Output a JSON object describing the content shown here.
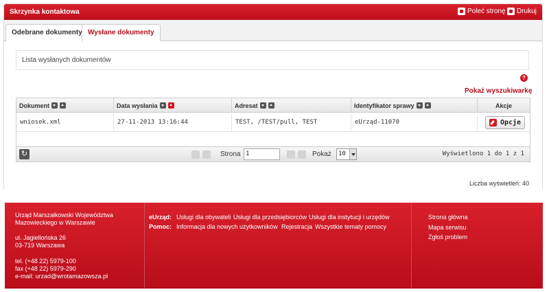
{
  "header": {
    "title": "Skrzynka kontaktowa",
    "recommend_label": "Poleć stronę",
    "print_label": "Drukuj"
  },
  "tabs": [
    {
      "label": "Odebrane dokumenty",
      "active": false
    },
    {
      "label": "Wysłane dokumenty",
      "active": true
    }
  ],
  "main": {
    "list_title": "Lista wysłanych dokumentów",
    "show_search_label": "Pokaż wyszukiwarkę"
  },
  "table": {
    "columns": [
      "Dokument",
      "Data wysłania",
      "Adresat",
      "Identyfikator sprawy",
      "Akcje"
    ],
    "rows": [
      {
        "document": "wniosek.xml",
        "date": "27-11-2013 13:16:44",
        "recipient": "TEST, /TEST/pull, TEST",
        "case_id": "eUrząd-11070",
        "action_label": "Opcje"
      }
    ]
  },
  "pager": {
    "page_label": "Strona",
    "page_value": "1",
    "of_text": "",
    "show_label": "Pokaż",
    "rows_value": "10",
    "view_info": "Wyświetlono 1 do 1 z 1"
  },
  "count_text": "Liczba wyświetleń: 40",
  "footer": {
    "org_line1": "Urząd Marszałkowski Województwa",
    "org_line2": "Mazowieckiego w Warszawie",
    "street": "ul. Jagiellońska 26",
    "city": "03-719 Warszawa",
    "tel": "tel. (+48 22) 5979-100",
    "fax": "fax (+48 22) 5979-290",
    "email": "e-mail: urzad@wrotamazowsza.pl",
    "eurzad_label": "eUrząd:",
    "eurzad_links": [
      "Usługi dla obywateli",
      "Usługi dla przedsiębiorców",
      "Usługi dla instytucji i urzędów"
    ],
    "pomoc_label": "Pomoc:",
    "pomoc_links": [
      "Informacja dla nowych użytkowników",
      "Rejestracja",
      "Wszystkie tematy pomocy"
    ],
    "right_links": [
      "Strona główna",
      "Mapa serwisu",
      "Zgłoś problem"
    ]
  }
}
